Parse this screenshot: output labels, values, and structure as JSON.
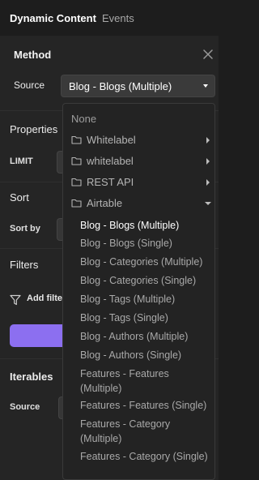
{
  "tabs": [
    {
      "label": "Dynamic Content",
      "active": true
    },
    {
      "label": "Events",
      "active": false
    }
  ],
  "method": {
    "title": "Method",
    "source_label": "Source",
    "source_value": "Blog - Blogs (Multiple)"
  },
  "properties": {
    "title": "Properties",
    "limit_label": "LIMIT"
  },
  "sort": {
    "title": "Sort",
    "sort_by_label": "Sort by"
  },
  "filters": {
    "title": "Filters",
    "add_filter_label": "Add filte"
  },
  "iterables": {
    "title": "Iterables",
    "source_label": "Source"
  },
  "dropdown": {
    "none_label": "None",
    "folders": [
      {
        "label": "Whitelabel",
        "expanded": false
      },
      {
        "label": "whitelabel",
        "expanded": false
      },
      {
        "label": "REST API",
        "expanded": false
      },
      {
        "label": "Airtable",
        "expanded": true
      }
    ],
    "options": [
      {
        "label": "Blog - Blogs (Multiple)",
        "selected": true
      },
      {
        "label": "Blog - Blogs (Single)",
        "selected": false
      },
      {
        "label": "Blog - Categories (Multiple)",
        "selected": false
      },
      {
        "label": "Blog - Categories (Single)",
        "selected": false
      },
      {
        "label": "Blog - Tags (Multiple)",
        "selected": false
      },
      {
        "label": "Blog - Tags (Single)",
        "selected": false
      },
      {
        "label": "Blog - Authors (Multiple)",
        "selected": false
      },
      {
        "label": "Blog - Authors (Single)",
        "selected": false
      },
      {
        "label": "Features - Features (Multiple)",
        "selected": false
      },
      {
        "label": "Features - Features (Single)",
        "selected": false
      },
      {
        "label": "Features - Category (Multiple)",
        "selected": false
      },
      {
        "label": "Features - Category (Single)",
        "selected": false
      }
    ]
  },
  "colors": {
    "accent": "#8c6ff0",
    "panel_bg": "#252525",
    "app_bg": "#1d1d1d"
  }
}
